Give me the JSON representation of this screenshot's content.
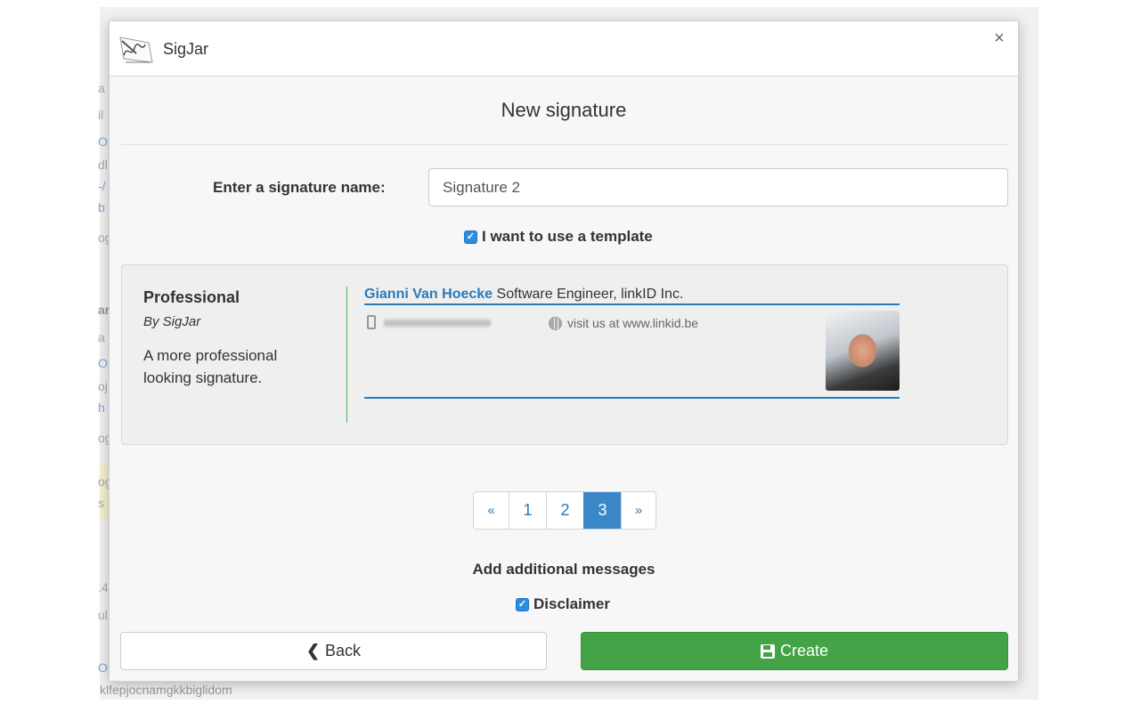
{
  "background": {
    "fragments": [
      "a",
      "il",
      "Op",
      "dl",
      "-/",
      "b",
      "og",
      "ar",
      "a",
      "Or",
      "oj",
      "h",
      "og",
      "og",
      "s",
      ".4",
      "ul",
      "Or"
    ],
    "bottom_text": "klfepjocnamgkkbiglidom"
  },
  "dialog": {
    "app_title": "SigJar",
    "close_glyph": "×",
    "heading": "New signature",
    "name_label": "Enter a signature name:",
    "name_value": "Signature 2",
    "use_template_label": "I want to use a template",
    "use_template_checked": true,
    "template": {
      "name": "Professional",
      "author": "By SigJar",
      "description": "A more professional looking signature.",
      "preview": {
        "person_name": "Gianni Van Hoecke",
        "role": "Software Engineer, linkID Inc.",
        "website_text": "visit us at www.linkid.be",
        "phone_icon": "mobile-phone-icon",
        "web_icon": "globe-icon",
        "accent_color": "#2a7ab8"
      }
    },
    "pagination": {
      "prev": "«",
      "pages": [
        "1",
        "2",
        "3"
      ],
      "active_page": "3",
      "next": "»"
    },
    "additional_title": "Add additional messages",
    "disclaimer_label": "Disclaimer",
    "disclaimer_checked": true,
    "back_label": "Back",
    "create_label": "Create"
  },
  "colors": {
    "primary": "#3a87c8",
    "success": "#44a347",
    "checkbox": "#2b8ce0"
  }
}
